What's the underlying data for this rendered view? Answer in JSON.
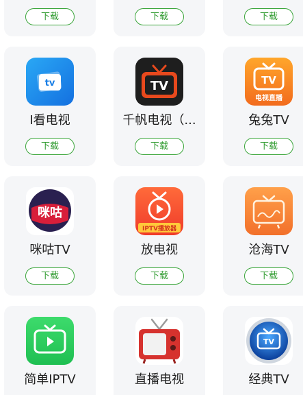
{
  "download_label": "下载",
  "apps": [
    {
      "name": "I看电视",
      "icon": "ikan-tv-icon"
    },
    {
      "name": "千帆电视（...",
      "icon": "qianfan-tv-icon"
    },
    {
      "name": "兔兔TV",
      "icon": "tutu-tv-icon",
      "icon_text": "电视直播"
    },
    {
      "name": "咪咕TV",
      "icon": "migu-tv-icon",
      "icon_text": "咪咕"
    },
    {
      "name": "放电视",
      "icon": "fang-tv-icon",
      "icon_text": "IPTV播放器"
    },
    {
      "name": "沧海TV",
      "icon": "canghai-tv-icon"
    },
    {
      "name": "简单IPTV",
      "icon": "jiandan-iptv-icon"
    },
    {
      "name": "直播电视",
      "icon": "zhibo-tv-icon"
    },
    {
      "name": "经典TV",
      "icon": "jingdian-tv-icon"
    }
  ],
  "colors": {
    "accent_green": "#2f9b2f",
    "card_bg": "#f5f6f8"
  }
}
